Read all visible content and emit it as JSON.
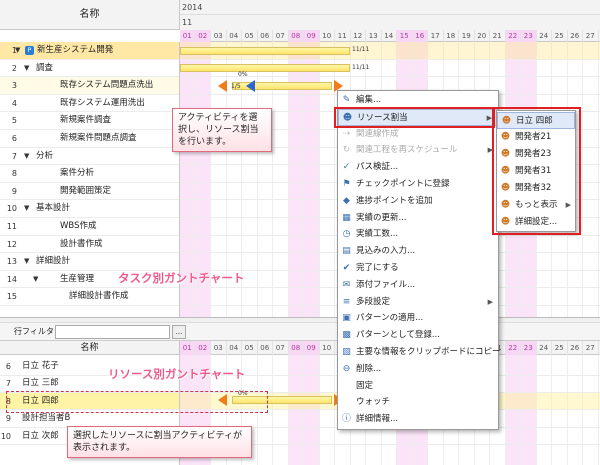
{
  "header": {
    "name_col": "名称",
    "year": "2014",
    "month": "11"
  },
  "days": [
    "01",
    "02",
    "03",
    "04",
    "05",
    "06",
    "07",
    "08",
    "09",
    "10",
    "11",
    "12",
    "13",
    "14",
    "15",
    "16",
    "17",
    "18",
    "19",
    "20",
    "21",
    "22",
    "23",
    "24",
    "25",
    "26",
    "27"
  ],
  "weekend_days": [
    "01",
    "02",
    "08",
    "09",
    "15",
    "16",
    "22",
    "23"
  ],
  "top_rows": [
    {
      "num": "1",
      "label": "新生産システム開発",
      "level": 0,
      "tri": "▼",
      "icon": "P"
    },
    {
      "num": "2",
      "label": "調査",
      "level": 1,
      "tri": "▼"
    },
    {
      "num": "3",
      "label": "既存システム問題点洗出",
      "level": 2
    },
    {
      "num": "4",
      "label": "既存システム運用洗出",
      "level": 2
    },
    {
      "num": "5",
      "label": "新規案件調査",
      "level": 2
    },
    {
      "num": "6",
      "label": "新規案件問題点調査",
      "level": 2
    },
    {
      "num": "7",
      "label": "分析",
      "level": 1,
      "tri": "▼"
    },
    {
      "num": "8",
      "label": "案件分析",
      "level": 2
    },
    {
      "num": "9",
      "label": "開発範囲策定",
      "level": 2
    },
    {
      "num": "10",
      "label": "基本設計",
      "level": 1,
      "tri": "▼"
    },
    {
      "num": "11",
      "label": "WBS作成",
      "level": 2
    },
    {
      "num": "12",
      "label": "設計書作成",
      "level": 2
    },
    {
      "num": "13",
      "label": "詳細設計",
      "level": 1,
      "tri": "▼"
    },
    {
      "num": "14",
      "label": "生産管理",
      "level": 2,
      "tri": "▼"
    },
    {
      "num": "15",
      "label": "詳細設計書作成",
      "level": 3
    }
  ],
  "bar_labels": {
    "row1_end": "11/11",
    "row2_end": "11/11",
    "row3_pct": "0%",
    "row3_mid": "1/5",
    "bottom_pct": "0%"
  },
  "filter": {
    "label": "行フィルタ",
    "button": "..."
  },
  "bottom": {
    "name_col": "名称"
  },
  "bottom_rows": [
    {
      "num": "6",
      "label": "日立 花子"
    },
    {
      "num": "7",
      "label": "日立 三郎"
    },
    {
      "num": "8",
      "label": "日立 四郎"
    },
    {
      "num": "9",
      "label": "設計担当者B"
    },
    {
      "num": "10",
      "label": "日立 次郎"
    }
  ],
  "menu": [
    {
      "label": "編集...",
      "icon": "✎",
      "disabled": false
    },
    {
      "label": "リソース割当",
      "icon": "☻",
      "disabled": false,
      "submenu": true,
      "highlight": true
    },
    {
      "label": "関連線作成",
      "icon": "⇢",
      "disabled": true
    },
    {
      "label": "関連工程を再スケジュール",
      "icon": "↻",
      "disabled": true,
      "submenu": true
    },
    {
      "label": "パス検証...",
      "icon": "✓",
      "disabled": false
    },
    {
      "label": "チェックポイントに登録",
      "icon": "⚑",
      "disabled": false
    },
    {
      "label": "進捗ポイントを追加",
      "icon": "◆",
      "disabled": false
    },
    {
      "label": "実績の更新...",
      "icon": "▦",
      "disabled": false
    },
    {
      "label": "実績工数...",
      "icon": "◷",
      "disabled": false
    },
    {
      "label": "見込みの入力...",
      "icon": "▤",
      "disabled": false
    },
    {
      "label": "完了にする",
      "icon": "✔",
      "disabled": false
    },
    {
      "label": "添付ファイル...",
      "icon": "✉",
      "disabled": false
    },
    {
      "label": "多段設定",
      "icon": "≡",
      "disabled": false,
      "submenu": true
    },
    {
      "label": "パターンの適用...",
      "icon": "▣",
      "disabled": false
    },
    {
      "label": "パターンとして登録...",
      "icon": "▩",
      "disabled": false
    },
    {
      "label": "主要な情報をクリップボードにコピー",
      "icon": "▧",
      "disabled": false
    },
    {
      "label": "削除...",
      "icon": "⊖",
      "disabled": false
    },
    {
      "label": "固定",
      "icon": "",
      "disabled": false
    },
    {
      "label": "ウォッチ",
      "icon": "",
      "disabled": false
    },
    {
      "label": "詳細情報...",
      "icon": "ⓘ",
      "disabled": false
    }
  ],
  "submenu": [
    {
      "label": "日立 四郎",
      "icon": "☻",
      "highlight": true
    },
    {
      "label": "開発者21",
      "icon": "☻"
    },
    {
      "label": "開発者23",
      "icon": "☻"
    },
    {
      "label": "開発者31",
      "icon": "☻"
    },
    {
      "label": "開発者32",
      "icon": "☻"
    },
    {
      "label": "もっと表示",
      "icon": "☻",
      "submenu": true
    },
    {
      "label": "詳細設定...",
      "icon": "☻"
    }
  ],
  "annotations": {
    "callout1": "アクティビティを選択し、リソース割当を行います。",
    "task_gantt": "タスク別ガントチャート",
    "resource_gantt": "リソース別ガントチャート",
    "callout2": "選択したリソースに割当アクティビティが表示されます。"
  },
  "colors": {
    "weekend": "#f7d7f3",
    "bar": "#ffe56a",
    "accent_red": "#e02020",
    "title_pink": "#ef5b8d"
  }
}
